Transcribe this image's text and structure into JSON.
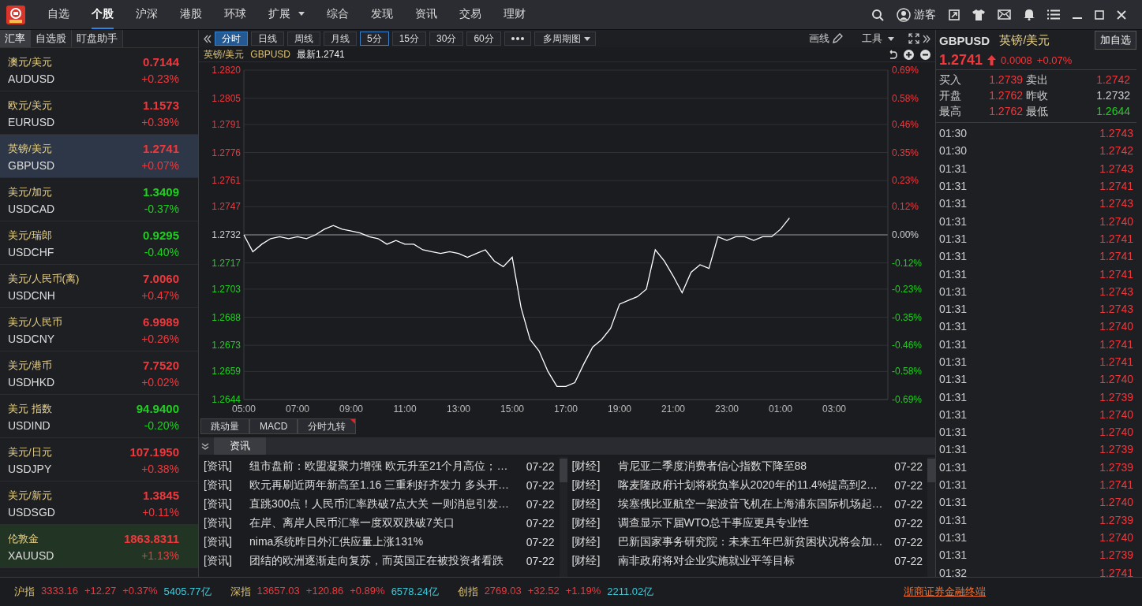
{
  "top_menu": [
    {
      "label": "自选",
      "selected": false,
      "dropdown": false
    },
    {
      "label": "个股",
      "selected": true,
      "dropdown": false
    },
    {
      "label": "沪深",
      "selected": false,
      "dropdown": false
    },
    {
      "label": "港股",
      "selected": false,
      "dropdown": false
    },
    {
      "label": "环球",
      "selected": false,
      "dropdown": false
    },
    {
      "label": "扩展",
      "selected": false,
      "dropdown": true
    },
    {
      "label": "综合",
      "selected": false,
      "dropdown": false
    },
    {
      "label": "发现",
      "selected": false,
      "dropdown": false
    },
    {
      "label": "资讯",
      "selected": false,
      "dropdown": false
    },
    {
      "label": "交易",
      "selected": false,
      "dropdown": false
    },
    {
      "label": "理财",
      "selected": false,
      "dropdown": false
    }
  ],
  "user": {
    "name": "游客"
  },
  "sidebar": {
    "tabs": [
      {
        "label": "汇率",
        "selected": true
      },
      {
        "label": "自选股",
        "selected": false
      },
      {
        "label": "盯盘助手",
        "selected": false
      }
    ],
    "items": [
      {
        "name": "澳元/美元",
        "code": "AUDUSD",
        "price": "0.7144",
        "change": "+0.23%",
        "up": true,
        "selected": false,
        "highlighted": false
      },
      {
        "name": "欧元/美元",
        "code": "EURUSD",
        "price": "1.1573",
        "change": "+0.39%",
        "up": true,
        "selected": false,
        "highlighted": false
      },
      {
        "name": "英镑/美元",
        "code": "GBPUSD",
        "price": "1.2741",
        "change": "+0.07%",
        "up": true,
        "selected": true,
        "highlighted": false
      },
      {
        "name": "美元/加元",
        "code": "USDCAD",
        "price": "1.3409",
        "change": "-0.37%",
        "up": false,
        "selected": false,
        "highlighted": false
      },
      {
        "name": "美元/瑞郎",
        "code": "USDCHF",
        "price": "0.9295",
        "change": "-0.40%",
        "up": false,
        "selected": false,
        "highlighted": false
      },
      {
        "name": "美元/人民币(离)",
        "code": "USDCNH",
        "price": "7.0060",
        "change": "+0.47%",
        "up": true,
        "selected": false,
        "highlighted": false
      },
      {
        "name": "美元/人民币",
        "code": "USDCNY",
        "price": "6.9989",
        "change": "+0.26%",
        "up": true,
        "selected": false,
        "highlighted": false
      },
      {
        "name": "美元/港币",
        "code": "USDHKD",
        "price": "7.7520",
        "change": "+0.02%",
        "up": true,
        "selected": false,
        "highlighted": false
      },
      {
        "name": "美元 指数",
        "code": "USDIND",
        "price": "94.9400",
        "change": "-0.20%",
        "up": false,
        "selected": false,
        "highlighted": false
      },
      {
        "name": "美元/日元",
        "code": "USDJPY",
        "price": "107.1950",
        "change": "+0.38%",
        "up": true,
        "selected": false,
        "highlighted": false
      },
      {
        "name": "美元/新元",
        "code": "USDSGD",
        "price": "1.3845",
        "change": "+0.11%",
        "up": true,
        "selected": false,
        "highlighted": false
      },
      {
        "name": "伦敦金",
        "code": "XAUUSD",
        "price": "1863.8311",
        "change": "+1.13%",
        "up": true,
        "selected": false,
        "highlighted": true
      }
    ]
  },
  "toolbar": {
    "periods": [
      {
        "label": "分时",
        "selected": true,
        "hovered": false
      },
      {
        "label": "日线",
        "selected": false,
        "hovered": false
      },
      {
        "label": "周线",
        "selected": false,
        "hovered": false
      },
      {
        "label": "月线",
        "selected": false,
        "hovered": false
      },
      {
        "label": "5分",
        "selected": false,
        "hovered": true
      },
      {
        "label": "15分",
        "selected": false,
        "hovered": false
      },
      {
        "label": "30分",
        "selected": false,
        "hovered": false
      },
      {
        "label": "60分",
        "selected": false,
        "hovered": false
      }
    ],
    "multi_period": "多周期图",
    "draw": "画线",
    "tools": "工具"
  },
  "chart": {
    "name": "英镑/美元",
    "latest": "最新1.2741",
    "percent_ticks": [
      {
        "label": "0.69%",
        "kind": "up"
      },
      {
        "label": "0.58%",
        "kind": "up"
      },
      {
        "label": "0.46%",
        "kind": "up"
      },
      {
        "label": "0.35%",
        "kind": "up"
      },
      {
        "label": "0.23%",
        "kind": "up"
      },
      {
        "label": "0.12%",
        "kind": "up"
      },
      {
        "label": "0.00%",
        "kind": "flat"
      },
      {
        "label": "-0.12%",
        "kind": "down"
      },
      {
        "label": "-0.23%",
        "kind": "down"
      },
      {
        "label": "-0.35%",
        "kind": "down"
      },
      {
        "label": "-0.46%",
        "kind": "down"
      },
      {
        "label": "-0.58%",
        "kind": "down"
      },
      {
        "label": "-0.69%",
        "kind": "down"
      }
    ],
    "chart_data": {
      "type": "line",
      "categories": [
        "05:00",
        null,
        null,
        null,
        null,
        null,
        "07:00",
        null,
        null,
        null,
        null,
        null,
        "09:00",
        null,
        null,
        null,
        null,
        null,
        "11:00",
        null,
        null,
        null,
        null,
        null,
        "13:00",
        null,
        null,
        null,
        null,
        null,
        "15:00",
        null,
        null,
        null,
        null,
        null,
        "17:00",
        null,
        null,
        null,
        null,
        null,
        "19:00",
        null,
        null,
        null,
        null,
        null,
        "21:00",
        null,
        null,
        null,
        null,
        null,
        "23:00",
        null,
        null,
        null,
        null,
        null,
        "01:00",
        null,
        null,
        null,
        null,
        null,
        "03:00"
      ],
      "series": [
        {
          "name": "GBPUSD",
          "color": "#ffffff",
          "values": [
            1.2732,
            1.2723,
            1.2727,
            1.273,
            1.2731,
            1.273,
            1.2731,
            1.273,
            1.2732,
            1.2735,
            1.2737,
            1.2735,
            1.2734,
            1.2733,
            1.2731,
            1.273,
            1.2727,
            1.2729,
            1.2727,
            1.2727,
            1.2724,
            1.2723,
            1.2722,
            1.2723,
            1.2722,
            1.272,
            1.2722,
            1.2724,
            1.2718,
            1.2715,
            1.272,
            1.2693,
            1.2676,
            1.267,
            1.2659,
            1.2651,
            1.2651,
            1.2653,
            1.2663,
            1.2672,
            1.2676,
            1.2682,
            1.2695,
            1.2697,
            1.2699,
            1.2703,
            1.2724,
            1.2718,
            1.271,
            1.2701,
            1.2712,
            1.2716,
            1.2714,
            1.2731,
            1.2729,
            1.2731,
            1.2731,
            1.2729,
            1.2731,
            1.2731,
            1.2735,
            1.2741,
            null,
            null,
            null,
            null,
            null
          ]
        }
      ],
      "ylim": [
        1.2644,
        1.282
      ],
      "yticks": [
        {
          "value": 1.282,
          "label": "1.2820"
        },
        {
          "value": 1.2805,
          "label": "1.2805"
        },
        {
          "value": 1.2791,
          "label": "1.2791"
        },
        {
          "value": 1.2776,
          "label": "1.2776"
        },
        {
          "value": 1.2761,
          "label": "1.2761"
        },
        {
          "value": 1.2747,
          "label": "1.2747"
        },
        {
          "value": 1.2732,
          "label": "1.2732"
        },
        {
          "value": 1.2717,
          "label": "1.2717"
        },
        {
          "value": 1.2703,
          "label": "1.2703"
        },
        {
          "value": 1.2688,
          "label": "1.2688"
        },
        {
          "value": 1.2673,
          "label": "1.2673"
        },
        {
          "value": 1.2659,
          "label": "1.2659"
        },
        {
          "value": 1.2644,
          "label": "1.2644"
        }
      ],
      "grid": true,
      "ref_lines": [
        {
          "axis": "y",
          "value": 1.2732
        }
      ]
    }
  },
  "indicator_tabs": [
    {
      "label": "跳动量",
      "flagged": false
    },
    {
      "label": "MACD",
      "flagged": false
    },
    {
      "label": "分时九转",
      "flagged": true
    }
  ],
  "news": {
    "tab": "资讯",
    "left": [
      {
        "tag": "[资讯]",
        "title": "纽市盘前：欧盟凝聚力增强 欧元升至21个月高位；…",
        "date": "07-22"
      },
      {
        "tag": "[资讯]",
        "title": "欧元再刷近两年新高至1.16 三重利好齐发力 多头开…",
        "date": "07-22"
      },
      {
        "tag": "[资讯]",
        "title": "直跳300点！人民币汇率跌破7点大关 一则消息引发…",
        "date": "07-22"
      },
      {
        "tag": "[资讯]",
        "title": "在岸、离岸人民币汇率一度双双跌破7关口",
        "date": "07-22"
      },
      {
        "tag": "[资讯]",
        "title": "nima系统昨日外汇供应量上涨131%",
        "date": "07-22"
      },
      {
        "tag": "[资讯]",
        "title": "团结的欧洲逐渐走向复苏，而英国正在被投资者看跌",
        "date": "07-22"
      }
    ],
    "right": [
      {
        "tag": "[财经]",
        "title": "肯尼亚二季度消费者信心指数下降至88",
        "date": "07-22"
      },
      {
        "tag": "[财经]",
        "title": "喀麦隆政府计划将税负率从2020年的11.4%提高到2…",
        "date": "07-22"
      },
      {
        "tag": "[财经]",
        "title": "埃塞俄比亚航空一架波音飞机在上海浦东国际机场起…",
        "date": "07-22"
      },
      {
        "tag": "[财经]",
        "title": "调查显示下届WTO总干事应更具专业性",
        "date": "07-22"
      },
      {
        "tag": "[财经]",
        "title": "巴新国家事务研究院：未来五年巴新贫困状况将会加…",
        "date": "07-22"
      },
      {
        "tag": "[财经]",
        "title": "南非政府将对企业实施就业平等目标",
        "date": "07-22"
      }
    ]
  },
  "quote": {
    "code": "GBPUSD",
    "name": "英镑/美元",
    "add_button": "加自选",
    "price": "1.2741",
    "up": true,
    "change": "0.0008",
    "change_pct": "+0.07%",
    "stats": [
      {
        "label": "买入",
        "value": "1.2739",
        "kind": "up"
      },
      {
        "label": "卖出",
        "value": "1.2742",
        "kind": "up"
      },
      {
        "label": "开盘",
        "value": "1.2762",
        "kind": "up"
      },
      {
        "label": "昨收",
        "value": "1.2732",
        "kind": "flat"
      },
      {
        "label": "最高",
        "value": "1.2762",
        "kind": "up"
      },
      {
        "label": "最低",
        "value": "1.2644",
        "kind": "down"
      }
    ],
    "ticks": [
      {
        "time": "01:30",
        "price": "1.2743"
      },
      {
        "time": "01:30",
        "price": "1.2742"
      },
      {
        "time": "01:31",
        "price": "1.2743"
      },
      {
        "time": "01:31",
        "price": "1.2741"
      },
      {
        "time": "01:31",
        "price": "1.2743"
      },
      {
        "time": "01:31",
        "price": "1.2740"
      },
      {
        "time": "01:31",
        "price": "1.2741"
      },
      {
        "time": "01:31",
        "price": "1.2741"
      },
      {
        "time": "01:31",
        "price": "1.2741"
      },
      {
        "time": "01:31",
        "price": "1.2743"
      },
      {
        "time": "01:31",
        "price": "1.2743"
      },
      {
        "time": "01:31",
        "price": "1.2740"
      },
      {
        "time": "01:31",
        "price": "1.2741"
      },
      {
        "time": "01:31",
        "price": "1.2741"
      },
      {
        "time": "01:31",
        "price": "1.2740"
      },
      {
        "time": "01:31",
        "price": "1.2739"
      },
      {
        "time": "01:31",
        "price": "1.2740"
      },
      {
        "time": "01:31",
        "price": "1.2740"
      },
      {
        "time": "01:31",
        "price": "1.2739"
      },
      {
        "time": "01:31",
        "price": "1.2739"
      },
      {
        "time": "01:31",
        "price": "1.2741"
      },
      {
        "time": "01:31",
        "price": "1.2740"
      },
      {
        "time": "01:31",
        "price": "1.2739"
      },
      {
        "time": "01:31",
        "price": "1.2740"
      },
      {
        "time": "01:31",
        "price": "1.2739"
      },
      {
        "time": "01:32",
        "price": "1.2741"
      }
    ]
  },
  "status_bar": {
    "indices": [
      {
        "name": "沪指",
        "value": "3333.16",
        "change": "+12.27",
        "pct": "+0.37%",
        "turnover": "5405.77亿"
      },
      {
        "name": "深指",
        "value": "13657.03",
        "change": "+120.86",
        "pct": "+0.89%",
        "turnover": "6578.24亿"
      },
      {
        "name": "创指",
        "value": "2769.03",
        "change": "+32.52",
        "pct": "+1.19%",
        "turnover": "2211.02亿"
      }
    ],
    "link": "浙商证券金融终端"
  }
}
